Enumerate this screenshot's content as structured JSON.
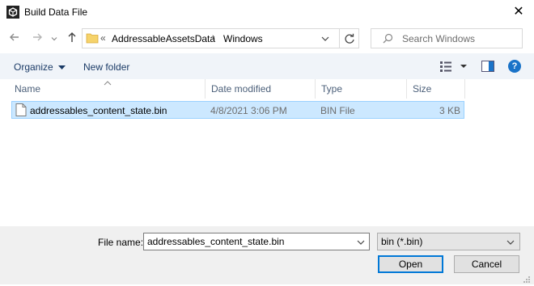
{
  "window": {
    "title": "Build Data File",
    "close_glyph": "✕"
  },
  "nav": {
    "breadcrumb_prefix": "«",
    "breadcrumb": [
      "AddressableAssetsData",
      "Windows"
    ],
    "search_placeholder": "Search Windows"
  },
  "toolbar": {
    "organize_label": "Organize",
    "new_folder_label": "New folder"
  },
  "columns": [
    {
      "label": "Name"
    },
    {
      "label": "Date modified"
    },
    {
      "label": "Type"
    },
    {
      "label": "Size"
    }
  ],
  "files": [
    {
      "name": "addressables_content_state.bin",
      "date": "4/8/2021 3:06 PM",
      "type": "BIN File",
      "size": "3 KB"
    }
  ],
  "footer": {
    "filename_label": "File name:",
    "filename_value": "addressables_content_state.bin",
    "filter_value": "bin (*.bin)",
    "open_label": "Open",
    "cancel_label": "Cancel"
  },
  "colors": {
    "accent": "#0078d7",
    "selection": "#cce8ff",
    "help": "#1a73c8",
    "folder": "#f6d36b"
  }
}
